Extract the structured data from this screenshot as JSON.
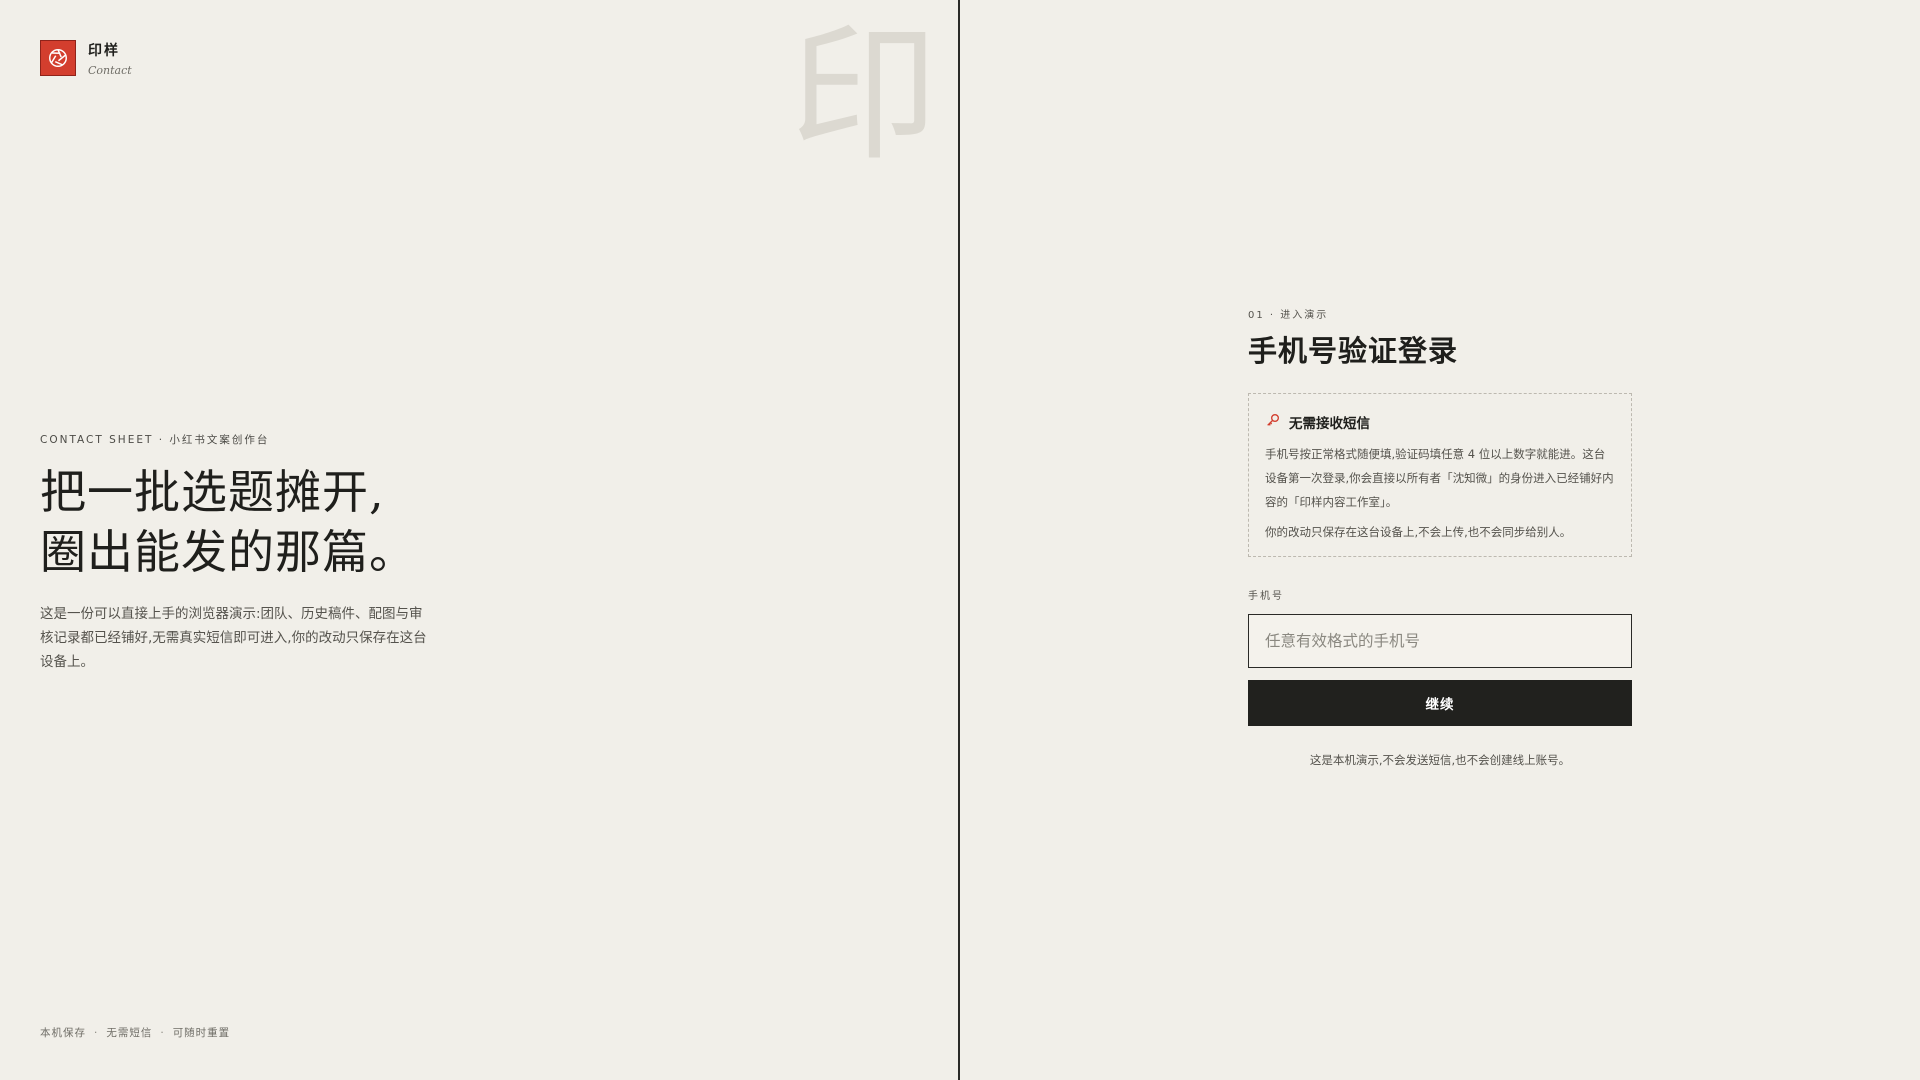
{
  "brand": {
    "name": "印样",
    "subtitle": "Contact"
  },
  "watermark": "印",
  "hero": {
    "eyebrow": "CONTACT SHEET · 小红书文案创作台",
    "headline_line1": "把一批选题摊开,",
    "headline_line2": "圈出能发的那篇。",
    "intro": "这是一份可以直接上手的浏览器演示:团队、历史稿件、配图与审核记录都已经铺好,无需真实短信即可进入,你的改动只保存在这台设备上。"
  },
  "footer": {
    "items": [
      "本机保存",
      "无需短信",
      "可随时重置"
    ],
    "separator": "·"
  },
  "login": {
    "step": "01 · 进入演示",
    "title": "手机号验证登录",
    "notice": {
      "icon": "key-icon",
      "title": "无需接收短信",
      "body": "手机号按正常格式随便填,验证码填任意 4 位以上数字就能进。这台设备第一次登录,你会直接以所有者「沈知微」的身份进入已经铺好内容的「印样内容工作室」。",
      "body2": "你的改动只保存在这台设备上,不会上传,也不会同步给别人。"
    },
    "phone_label": "手机号",
    "phone_value": "",
    "phone_placeholder": "任意有效格式的手机号",
    "continue_label": "继续",
    "demo_note": "这是本机演示,不会发送短信,也不会创建线上账号。"
  },
  "colors": {
    "background": "#f1efe9",
    "brand_red": "#d33e2e",
    "button_dark": "#21211e",
    "text_dark": "#1f1f1c"
  }
}
